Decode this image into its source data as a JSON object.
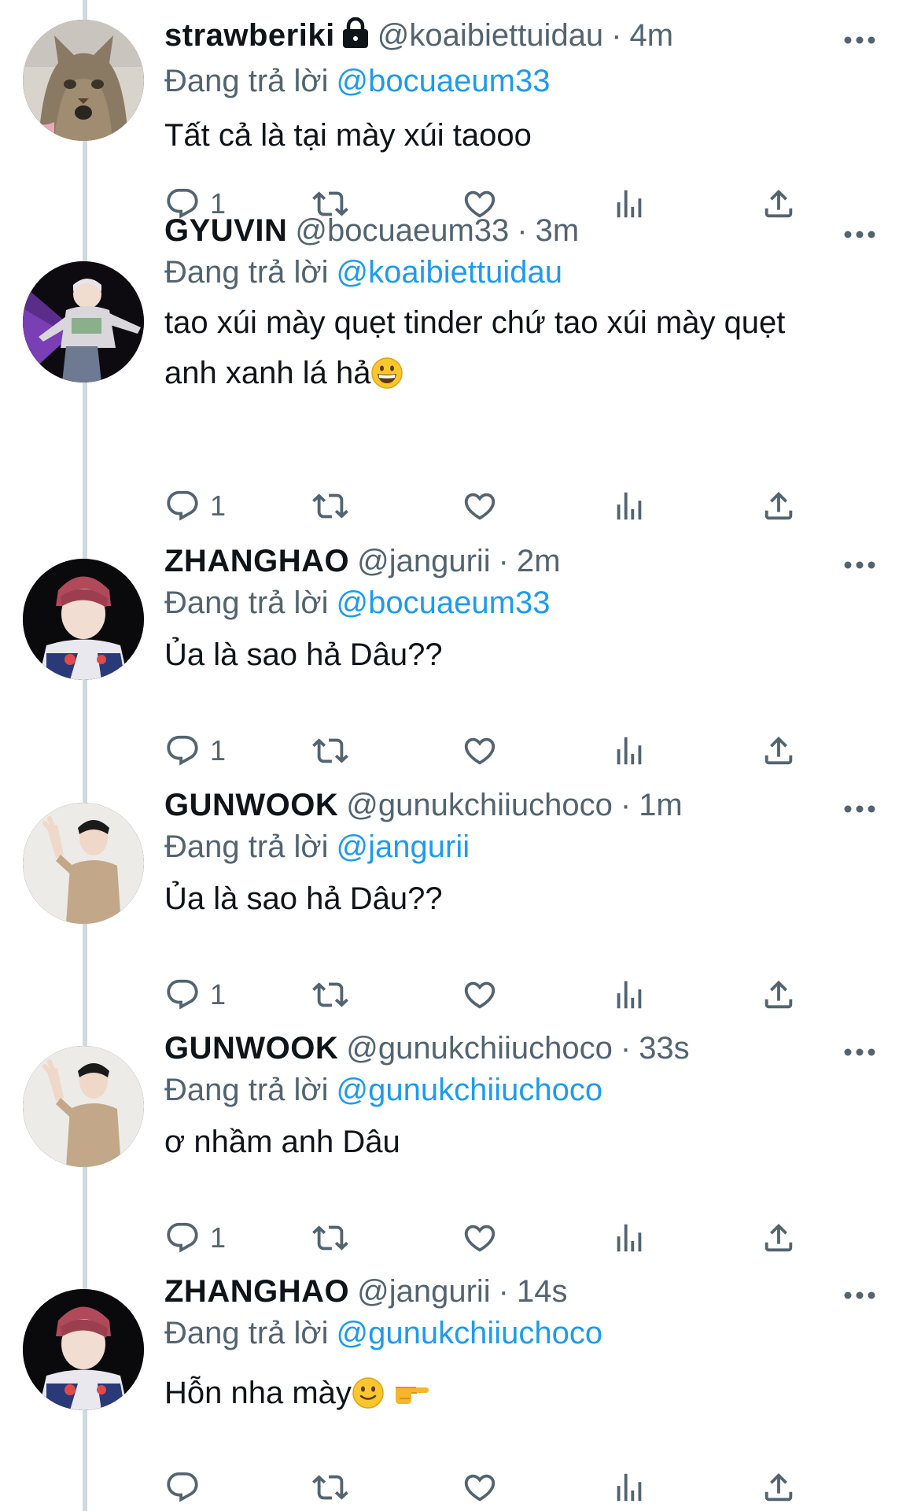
{
  "tweets": [
    {
      "name": "strawberiki",
      "locked": true,
      "handle": "@koaibiettuidau",
      "time": "4m",
      "reply_prefix": "Đang trả lời",
      "reply_to": "@bocuaeum33",
      "text": "Tất cả là tại mày xúi taooo",
      "reply_count": "1",
      "avatar": "cat-photo"
    },
    {
      "name": "GYUVIN",
      "locked": false,
      "handle": "@bocuaeum33",
      "time": "3m",
      "reply_prefix": "Đang trả lời",
      "reply_to": "@koaibiettuidau",
      "text_line1": "tao xúi mày quẹt tinder chứ tao xúi mày quẹt",
      "text_line2": "anh xanh lá hả",
      "emoji": "grinning-face-emoji",
      "reply_count": "1",
      "avatar": "gyuvin-photo"
    },
    {
      "name": "ZHANGHAO",
      "locked": false,
      "handle": "@jangurii",
      "time": "2m",
      "reply_prefix": "Đang trả lời",
      "reply_to": "@bocuaeum33",
      "text": "Ủa là sao hả Dâu??",
      "reply_count": "1",
      "avatar": "zhanghao-photo"
    },
    {
      "name": "GUNWOOK",
      "locked": false,
      "handle": "@gunukchiiuchoco",
      "time": "1m",
      "reply_prefix": "Đang trả lời",
      "reply_to": "@jangurii",
      "text": "Ủa là sao hả Dâu??",
      "reply_count": "1",
      "avatar": "gunwook-photo"
    },
    {
      "name": "GUNWOOK",
      "locked": false,
      "handle": "@gunukchiiuchoco",
      "time": "33s",
      "reply_prefix": "Đang trả lời",
      "reply_to": "@gunukchiiuchoco",
      "text": "ơ nhầm anh Dâu",
      "reply_count": "1",
      "avatar": "gunwook-photo"
    },
    {
      "name": "ZHANGHAO",
      "locked": false,
      "handle": "@jangurii",
      "time": "14s",
      "reply_prefix": "Đang trả lời",
      "reply_to": "@gunukchiiuchoco",
      "text": "Hỗn nha mày",
      "emoji": "slightly-smiling-face-emoji, pointing-hand-emoji",
      "reply_count": "",
      "avatar": "zhanghao-photo"
    }
  ],
  "separator": "·",
  "colors": {
    "text": "#0f1419",
    "secondary": "#536471",
    "link": "#1d9bf0",
    "thread_line": "#cfd9de"
  }
}
